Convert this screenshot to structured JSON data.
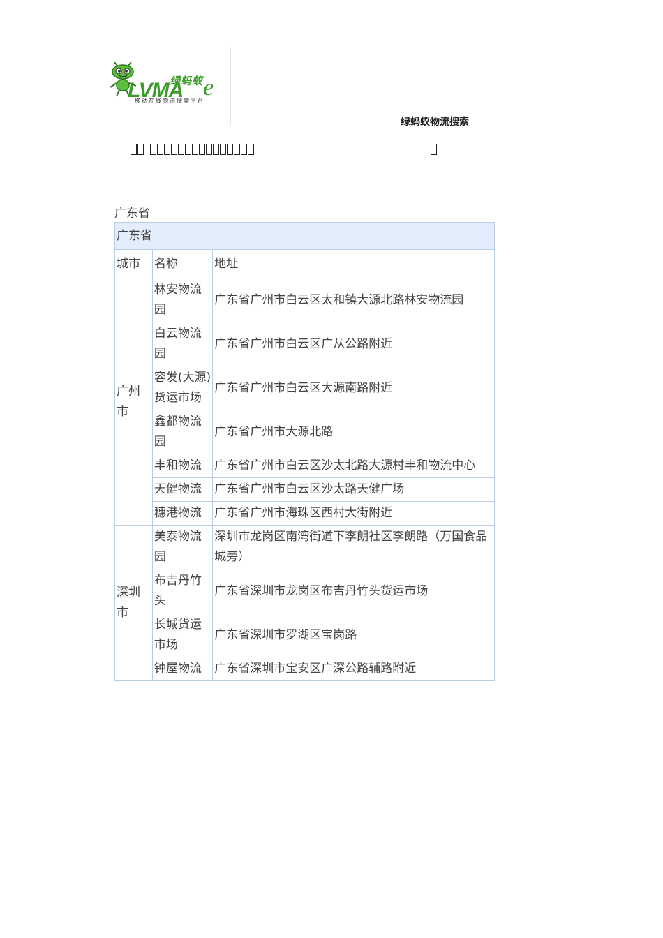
{
  "header": {
    "logo": {
      "name_cn": "绿蚂蚁",
      "name_en": "LVMA",
      "e_glyph": "e",
      "tagline": "移动在线物流搜索平台"
    },
    "site_title": "绿蚂蚁物流搜索",
    "garbled_line": {
      "prefix_boxes": 2,
      "main_boxes": 15,
      "trailing_boxes": 1
    }
  },
  "content": {
    "province_label": "广东省",
    "table": {
      "province_header": "广东省",
      "columns": [
        "城市",
        "名称",
        "地址"
      ],
      "groups": [
        {
          "city": "广州市",
          "rows": [
            {
              "name": "林安物流园",
              "address": "广东省广州市白云区太和镇大源北路林安物流园"
            },
            {
              "name": "白云物流园",
              "address": "广东省广州市白云区广从公路附近"
            },
            {
              "name": "容发(大源)货运市场",
              "address": "广东省广州市白云区大源南路附近"
            },
            {
              "name": "鑫都物流园",
              "address": "广东省广州市大源北路"
            },
            {
              "name": "丰和物流",
              "address": "广东省广州市白云区沙太北路大源村丰和物流中心"
            },
            {
              "name": "天健物流",
              "address": "广东省广州市白云区沙太路天健广场"
            },
            {
              "name": "穗港物流",
              "address": "广东省广州市海珠区西村大街附近"
            }
          ]
        },
        {
          "city": "深圳市",
          "rows": [
            {
              "name": "美泰物流园",
              "address": "深圳市龙岗区南湾街道下李朗社区李朗路（万国食品城旁）"
            },
            {
              "name": "布吉丹竹头",
              "address": "广东省深圳市龙岗区布吉丹竹头货运市场"
            },
            {
              "name": "长城货运市场",
              "address": "广东省深圳市罗湖区宝岗路"
            },
            {
              "name": "钟屋物流",
              "address": "广东省深圳市宝安区广深公路辅路附近"
            }
          ]
        }
      ]
    }
  }
}
